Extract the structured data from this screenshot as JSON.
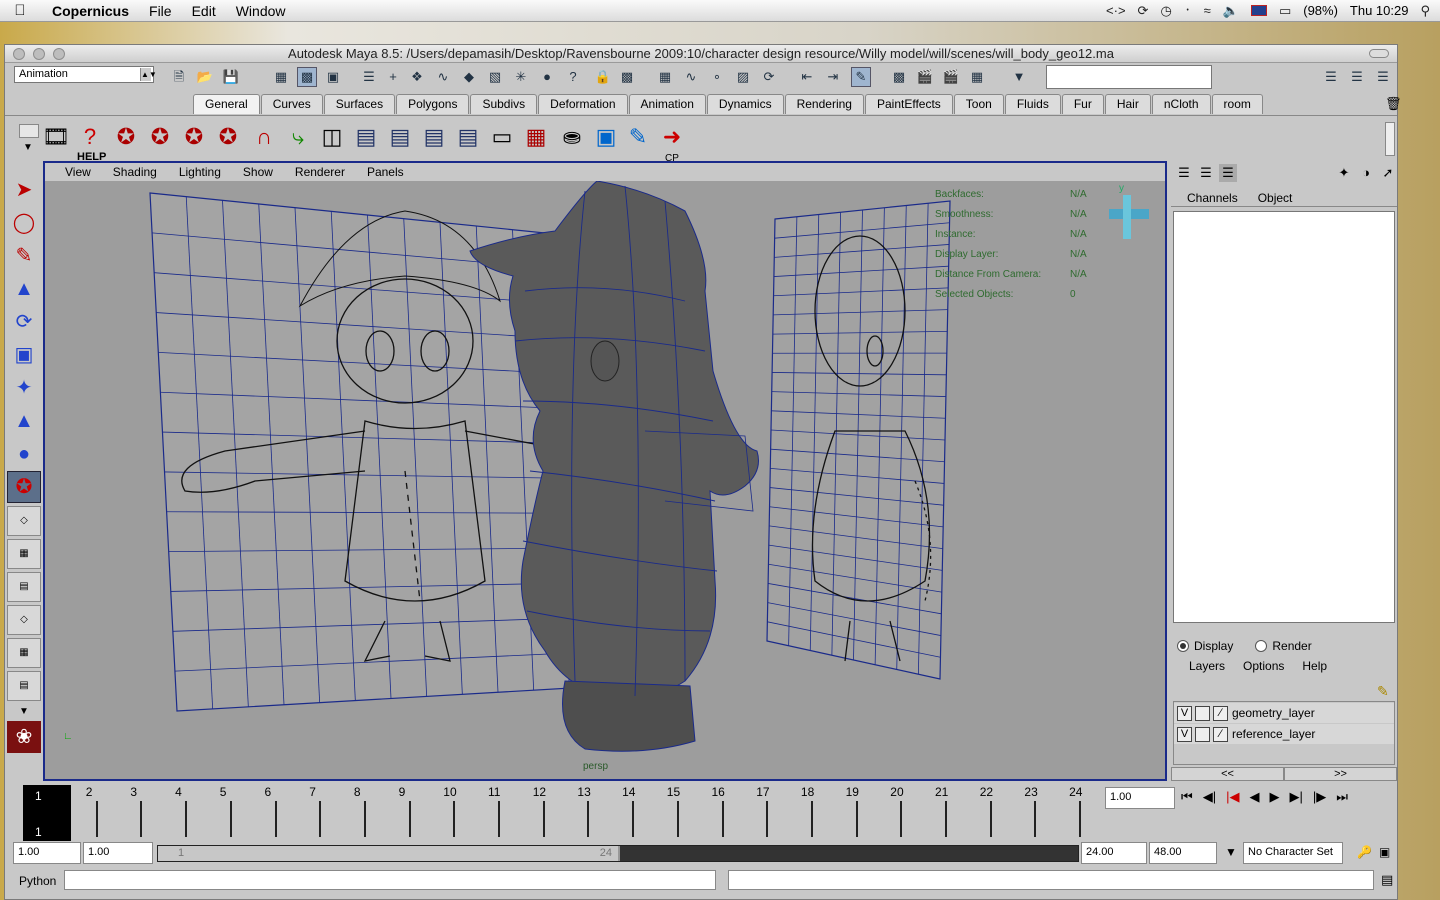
{
  "menubar": {
    "app_name": "Copernicus",
    "items": [
      "File",
      "Edit",
      "Window"
    ],
    "battery": "(98%)",
    "clock": "Thu 10:29"
  },
  "window": {
    "title": "Autodesk Maya 8.5: /Users/depamasih/Desktop/Ravensbourne 2009:10/character design resource/Willy model/will/scenes/will_body_geo12.ma"
  },
  "status_line": {
    "mode": "Animation"
  },
  "shelf": {
    "tabs": [
      "General",
      "Curves",
      "Surfaces",
      "Polygons",
      "Subdivs",
      "Deformation",
      "Animation",
      "Dynamics",
      "Rendering",
      "PaintEffects",
      "Toon",
      "Fluids",
      "Fur",
      "Hair",
      "nCloth",
      "room"
    ],
    "active_tab": "General",
    "help_label": "HELP",
    "cp_label": "CP"
  },
  "viewport": {
    "menu": [
      "View",
      "Shading",
      "Lighting",
      "Show",
      "Renderer",
      "Panels"
    ],
    "hud": [
      {
        "label": "Backfaces:",
        "value": "N/A"
      },
      {
        "label": "Smoothness:",
        "value": "N/A"
      },
      {
        "label": "Instance:",
        "value": "N/A"
      },
      {
        "label": "Display Layer:",
        "value": "N/A"
      },
      {
        "label": "Distance From Camera:",
        "value": "N/A"
      },
      {
        "label": "Selected Objects:",
        "value": "0"
      }
    ],
    "camera": "persp",
    "axis_y": "y"
  },
  "channel_box": {
    "menu": [
      "Channels",
      "Object"
    ],
    "layer_modes": [
      "Display",
      "Render"
    ],
    "layer_menu": [
      "Layers",
      "Options",
      "Help"
    ],
    "layers": [
      {
        "visible": "V",
        "name": "geometry_layer"
      },
      {
        "visible": "V",
        "name": "reference_layer"
      }
    ],
    "nav_prev": "<<",
    "nav_next": ">>"
  },
  "time_slider": {
    "frames": [
      "1",
      "2",
      "3",
      "4",
      "5",
      "6",
      "7",
      "8",
      "9",
      "10",
      "11",
      "12",
      "13",
      "14",
      "15",
      "16",
      "17",
      "18",
      "19",
      "20",
      "21",
      "22",
      "23",
      "24"
    ],
    "current_frame": "1",
    "current_time": "1.00"
  },
  "range_slider": {
    "start_time": "1.00",
    "playback_start": "1.00",
    "range_start_label": "1",
    "range_end_label": "24",
    "playback_end": "24.00",
    "end_time": "48.00",
    "character_set": "No Character Set"
  },
  "command_line": {
    "language": "Python"
  },
  "colors": {
    "viewport_bg": "#9d9d9d",
    "wireframe": "#1a2a8a",
    "hud_text": "#2f6b2f"
  }
}
